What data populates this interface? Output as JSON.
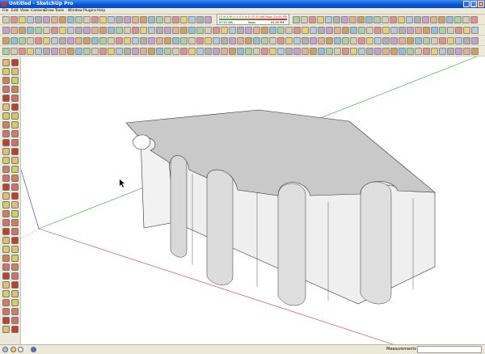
{
  "window": {
    "title": "Untitled - SketchUp Pro"
  },
  "menu": [
    "File",
    "Edit",
    "View",
    "Camera",
    "Draw",
    "Tools",
    "Window",
    "Plugins",
    "Help"
  ],
  "shadow_settings": {
    "ticks": "J F M A M J J A S O N D   07:20 AM   Noon   04:45 PM",
    "time_label": "07:20 AM",
    "noon_label": "Noon",
    "end_label": "04:45 PM",
    "soft_label": "Soft"
  },
  "statusbar": {
    "measurements_label": "Measurements",
    "measurements_value": ""
  },
  "icons": {
    "toolbar_colors": [
      "#d8ccb0",
      "#b4c8e0",
      "#e0b090",
      "#a8d0a0",
      "#e8d070",
      "#c8a0d0",
      "#90c0d8",
      "#e09090",
      "#b0b0b0",
      "#d0a060"
    ],
    "left_colors": [
      "#e0c070",
      "#c8d8a0",
      "#d08060",
      "#90b0d0",
      "#c04030",
      "#a0a0c0",
      "#d0d060",
      "#80b080",
      "#d07070",
      "#9090d0"
    ]
  },
  "colors": {
    "axis_red": "#c83232",
    "axis_green": "#2aa02a",
    "axis_blue": "#2a2ad0",
    "model_top": "#c9c9c9",
    "model_side": "#ededed"
  }
}
